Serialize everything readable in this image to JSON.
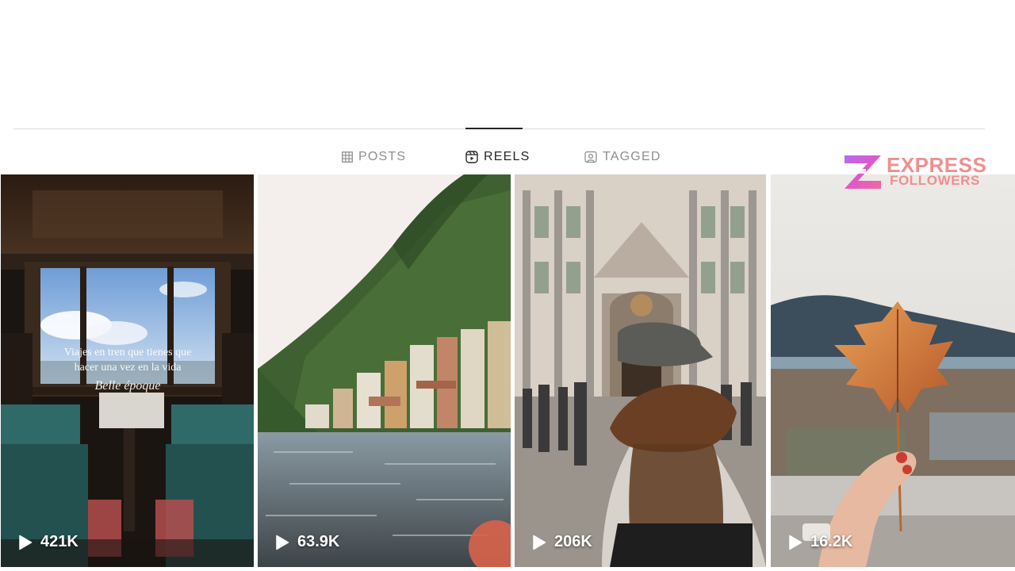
{
  "tabs": [
    {
      "label": "POSTS",
      "icon": "grid-icon",
      "active": false
    },
    {
      "label": "REELS",
      "icon": "reels-icon",
      "active": true
    },
    {
      "label": "TAGGED",
      "icon": "tagged-icon",
      "active": false
    }
  ],
  "reels": [
    {
      "views": "421K",
      "caption": {
        "line1": "Viajes en tren que tienes que",
        "line2": "hacer una vez en la vida",
        "line3": "Belle époque"
      }
    },
    {
      "views": "63.9K"
    },
    {
      "views": "206K"
    },
    {
      "views": "16.2K"
    }
  ],
  "watermark": {
    "line1": "EXPRESS",
    "line2": "FOLLOWERS"
  },
  "colors": {
    "active_tab": "#262626",
    "inactive_tab": "#8e8e8e",
    "divider": "#dbdbdb",
    "watermark": "#ef8f8f"
  }
}
